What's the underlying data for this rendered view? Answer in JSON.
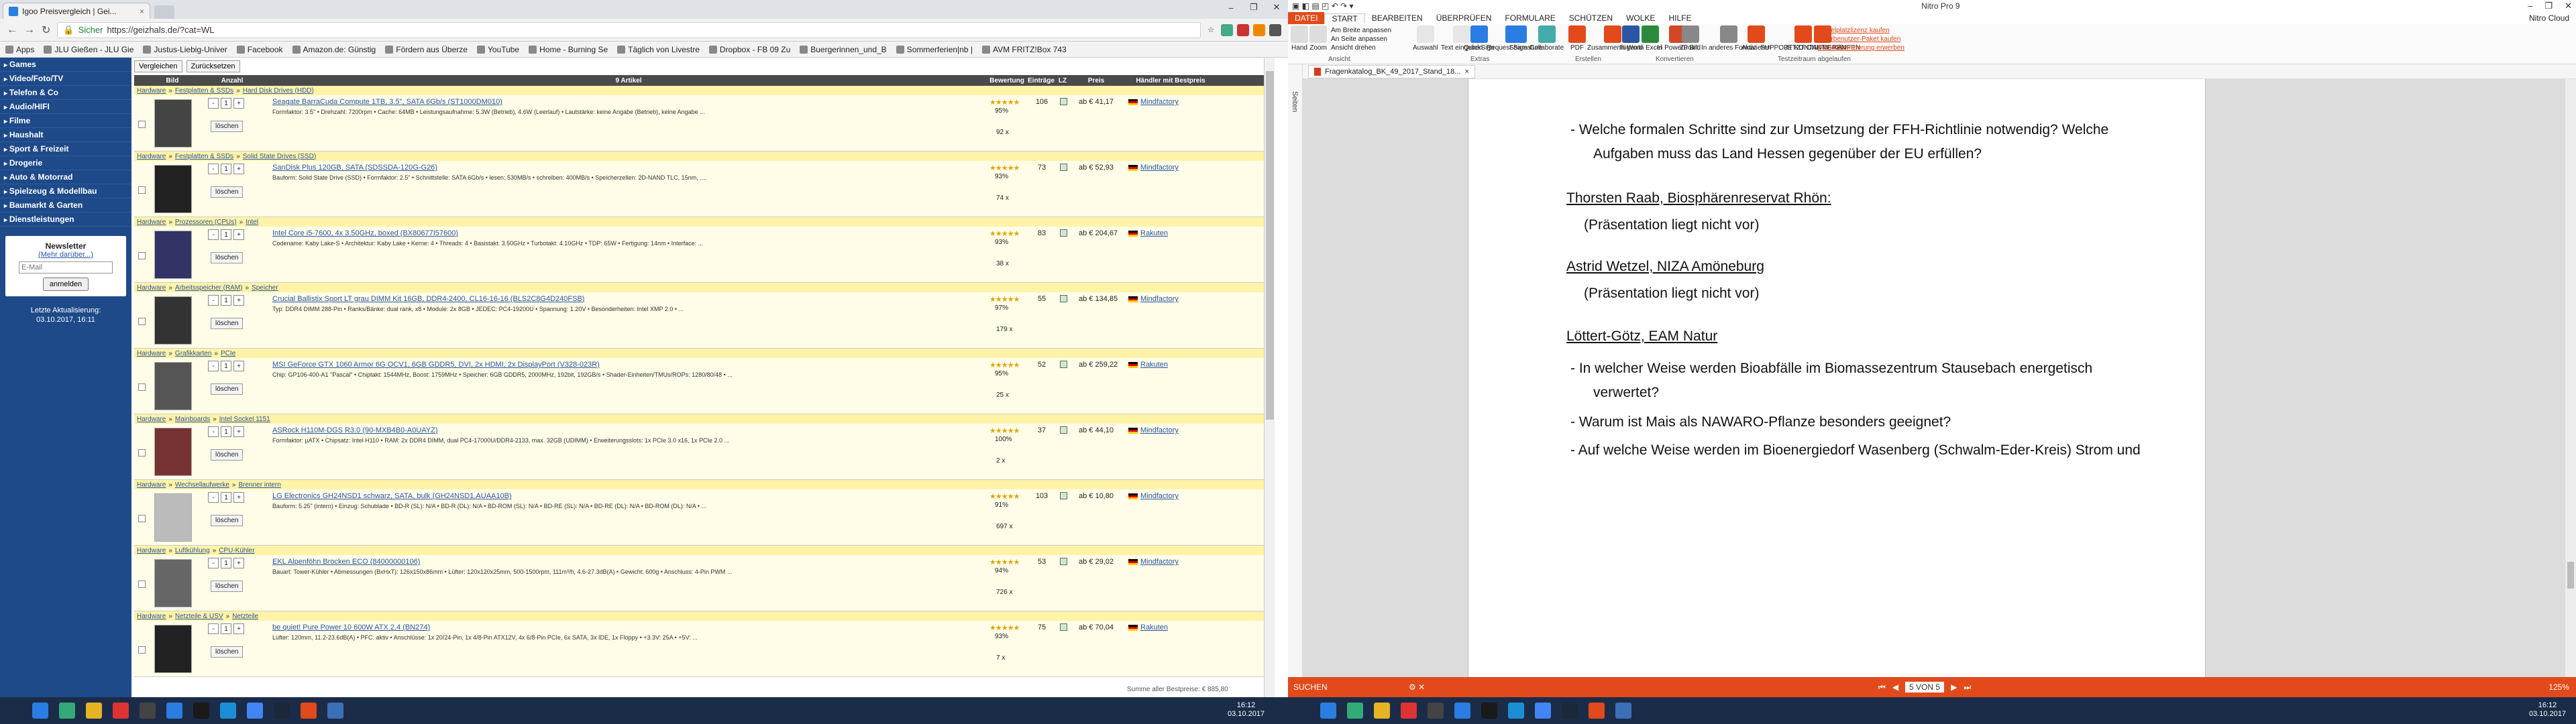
{
  "browser": {
    "tab_title": "Igoo Preisvergleich | Gei...",
    "url_secure": "Sicher",
    "url": "https://geizhals.de/?cat=WL",
    "bookmarks": [
      "Apps",
      "JLU Gießen - JLU Gie",
      "Justus-Liebig-Univer",
      "Facebook",
      "Amazon.de: Günstig",
      "Fördern aus Überze",
      "YouTube",
      "Home - Burning Se",
      "Täglich von Livestre",
      "Dropbox - FB 09 Zu",
      "Buergerinnen_und_B",
      "Sommerferien|nb |",
      "AVM FRITZ!Box 743"
    ]
  },
  "sidebar": {
    "categories": [
      "Games",
      "Video/Foto/TV",
      "Telefon & Co",
      "Audio/HIFI",
      "Filme",
      "Haushalt",
      "Sport & Freizeit",
      "Drogerie",
      "Auto & Motorrad",
      "Spielzeug & Modellbau",
      "Baumarkt & Garten",
      "Dienstleistungen"
    ],
    "newsletter_title": "Newsletter",
    "newsletter_more": "(Mehr darüber...)",
    "email_placeholder": "E-Mail",
    "subscribe": "anmelden",
    "update_label": "Letzte Aktualisierung:",
    "update_time": "03.10.2017, 16:11"
  },
  "toolbar": {
    "compare": "Vergleichen",
    "reset": "Zurücksetzen"
  },
  "columns": {
    "bild": "Bild",
    "anzahl": "Anzahl",
    "artikel": "9 Artikel",
    "bewertung": "Bewertung",
    "eintraege": "Einträge",
    "lz": "LZ",
    "preis": "Preis",
    "haendler": "Händler mit Bestpreis"
  },
  "row_labels": {
    "qty": "1",
    "delete": "löschen",
    "stars": "★★★★★"
  },
  "items": [
    {
      "c1": "Hardware",
      "c2": "Festplatten & SSDs",
      "c3": "Hard Disk Drives (HDD)",
      "title": "Seagate BarraCuda Compute 1TB, 3.5\", SATA 6Gb/s (ST1000DM010)",
      "desc": "Formfaktor: 3.5\" • Drehzahl: 7200rpm • Cache: 64MB • Leistungsaufnahme: 5.3W (Betrieb), 4.6W (Leerlauf) • Lautstärke: keine Angabe (Betrieb), keine Angabe ...",
      "pct": "95%",
      "cnt": "92 x",
      "ein": "106",
      "price": "ab € 41,17",
      "dealer": "Mindfactory"
    },
    {
      "c1": "Hardware",
      "c2": "Festplatten & SSDs",
      "c3": "Solid State Drives (SSD)",
      "title": "SanDisk Plus 120GB, SATA (SDSSDA-120G-G26)",
      "desc": "Bauform: Solid State Drive (SSD) • Formfaktor: 2.5\" • Schnittstelle: SATA 6Gb/s • lesen: 530MB/s • schreiben: 400MB/s • Speicherzellen: 2D-NAND TLC, 15nm, ....",
      "pct": "93%",
      "cnt": "74 x",
      "ein": "73",
      "price": "ab € 52,93",
      "dealer": "Mindfactory"
    },
    {
      "c1": "Hardware",
      "c2": "Prozessoren (CPUs)",
      "c3": "Intel",
      "title": "Intel Core i5-7600, 4x 3.50GHz, boxed (BX80677I57600)",
      "desc": "Codename: Kaby Lake-S • Architektur: Kaby Lake • Kerne: 4 • Threads: 4 • Basistakt: 3.50GHz • Turbotakt: 4.10GHz • TDP: 65W • Fertigung: 14nm • Interface: ...",
      "pct": "93%",
      "cnt": "38 x",
      "ein": "83",
      "price": "ab € 204,67",
      "dealer": "Rakuten"
    },
    {
      "c1": "Hardware",
      "c2": "Arbeitsspeicher (RAM)",
      "c3": "Speicher",
      "title": "Crucial Ballistix Sport LT grau DIMM Kit 16GB, DDR4-2400, CL16-16-16 (BLS2C8G4D240FSB)",
      "desc": "Typ: DDR4 DIMM 288-Pin • Ranks/Bänke: dual rank, x8 • Module: 2x 8GB • JEDEC: PC4-19200U • Spannung: 1.20V • Besonderheiten: Intel XMP 2.0 • ...",
      "pct": "97%",
      "cnt": "179 x",
      "ein": "55",
      "price": "ab € 134,85",
      "dealer": "Mindfactory"
    },
    {
      "c1": "Hardware",
      "c2": "Grafikkarten",
      "c3": "PCIe",
      "title": "MSI GeForce GTX 1060 Armor 6G OCV1, 6GB GDDR5, DVI, 2x HDMI, 2x DisplayPort (V328-023R)",
      "desc": "Chip: GP106-400-A1 \"Pascal\" • Chiptakt: 1544MHz, Boost: 1759MHz • Speicher: 6GB GDDR5, 2000MHz, 192bit, 192GB/s • Shader-Einheiten/TMUs/ROPs: 1280/80/48 • ...",
      "pct": "95%",
      "cnt": "25 x",
      "ein": "52",
      "price": "ab € 259,22",
      "dealer": "Rakuten"
    },
    {
      "c1": "Hardware",
      "c2": "Mainboards",
      "c3": "Intel Sockel 1151",
      "title": "ASRock H110M-DGS R3.0 (90-MXB4B0-A0UAYZ)",
      "desc": "Formfaktor: µATX • Chipsatz: Intel H110 • RAM: 2x DDR4 DIMM, dual PC4-17000U/DDR4-2133, max. 32GB (UDIMM) • Erweiterungsslots: 1x PCIe 3.0 x16, 1x PCIe 2.0 ...",
      "pct": "100%",
      "cnt": "2 x",
      "ein": "37",
      "price": "ab € 44,10",
      "dealer": "Mindfactory"
    },
    {
      "c1": "Hardware",
      "c2": "Wechsellaufwerke",
      "c3": "Brenner intern",
      "title": "LG Electronics GH24NSD1 schwarz, SATA, bulk (GH24NSD1.AUAA10B)",
      "desc": "Bauform: 5.25\" (intern) • Einzug: Schublade • BD-R (SL): N/A • BD-R (DL): N/A • BD-ROM (SL): N/A • BD-RE (SL): N/A • BD-RE (DL): N/A • BD-ROM (DL): N/A • ...",
      "pct": "91%",
      "cnt": "697 x",
      "ein": "103",
      "price": "ab € 10,80",
      "dealer": "Mindfactory"
    },
    {
      "c1": "Hardware",
      "c2": "Luftkühlung",
      "c3": "CPU-Kühler",
      "title": "EKL Alpenföhn Brocken ECO (84000000106)",
      "desc": "Bauart: Tower-Kühler • Abmessungen (BxHxT): 126x150x86mm • Lüfter: 120x120x25mm, 500-1500rpm, 111m³/h, 4.6-27.3dB(A) • Gewicht: 600g • Anschluss: 4-Pin PWM ...",
      "pct": "94%",
      "cnt": "726 x",
      "ein": "53",
      "price": "ab € 29,02",
      "dealer": "Mindfactory"
    },
    {
      "c1": "Hardware",
      "c2": "Netzteile & USV",
      "c3": "Netzteile",
      "title": "be quiet! Pure Power 10 600W ATX 2.4 (BN274)",
      "desc": "Lüfter: 120mm, 11.2-23.6dB(A) • PFC: aktiv • Anschlüsse: 1x 20/24-Pin, 1x 4/8-Pin ATX12V, 4x 6/8-Pin PCIe, 6x SATA, 3x IDE, 1x Floppy • +3.3V: 25A • +5V: ...",
      "pct": "93%",
      "cnt": "7 x",
      "ein": "75",
      "price": "ab € 70,04",
      "dealer": "Rakuten"
    }
  ],
  "sum_label": "Summe aller Bestpreise: € 885,80",
  "nitro": {
    "app_title": "Nitro Pro 9",
    "menus": [
      "DATEI",
      "START",
      "BEARBEITEN",
      "ÜBERPRÜFEN",
      "FORMULARE",
      "SCHÜTZEN",
      "WOLKE",
      "HILFE"
    ],
    "user": "Nitro Cloud",
    "ribbon": [
      "Hand",
      "Zoom",
      "Auswahl",
      "Text eingeben",
      "QuickSign",
      "Request Signature",
      "Share",
      "Collaborate",
      "PDF",
      "Zusammenfügen",
      "In Word",
      "In Excel",
      "In PowerPoint",
      "Zu Bild",
      "In anderes Format",
      "Aktivieren",
      "SUPPORT KONTAKTIEREN",
      "JETZT ONLINE KAUFEN"
    ],
    "view": [
      "Am Breite anpassen",
      "An Seite anpassen",
      "Ansicht drehen"
    ],
    "groups": [
      "Ansicht",
      "Extras",
      "Erstellen",
      "Konvertieren",
      "Testzeitraum abgelaufen"
    ],
    "links": [
      "Einzelplatzlizenz kaufen",
      "Mehrbenutzer-Paket kaufen",
      "Firmenlizenzierung erwerben"
    ],
    "side_label": "Seiten",
    "doc_tab": "Fragenkatalog_BK_49_2017_Stand_18...",
    "lines": [
      {
        "type": "b",
        "text": "-   Welche formalen Schritte sind zur Umsetzung der FFH-Richtlinie notwendig? Welche"
      },
      {
        "type": "c",
        "text": "Aufgaben muss das Land Hessen gegenüber der EU erfüllen?"
      },
      {
        "type": "h",
        "text": "Thorsten Raab, Biosphärenreservat Rhön:"
      },
      {
        "type": "i",
        "text": "(Präsentation liegt nicht vor)"
      },
      {
        "type": "h",
        "text": "Astrid Wetzel, NIZA Amöneburg"
      },
      {
        "type": "i",
        "text": "(Präsentation liegt nicht vor)"
      },
      {
        "type": "h",
        "text": "Löttert-Götz, EAM Natur"
      },
      {
        "type": "b",
        "text": "-   In welcher Weise werden Bioabfälle im Biomassezentrum Stausebach energetisch"
      },
      {
        "type": "c",
        "text": "verwertet?"
      },
      {
        "type": "b",
        "text": "-   Warum ist Mais als NAWARO-Pflanze besonders geeignet?"
      },
      {
        "type": "b",
        "text": "-   Auf welche Weise werden im Bioenergiedorf Wasenberg (Schwalm-Eder-Kreis) Strom und"
      }
    ],
    "search": "SUCHEN",
    "page": "5 VON 5",
    "zoom": "125%"
  },
  "taskbar": {
    "time_left": "16:12",
    "date_left": "03.10.2017",
    "time_right": "16:12",
    "date_right": "03.10.2017"
  }
}
